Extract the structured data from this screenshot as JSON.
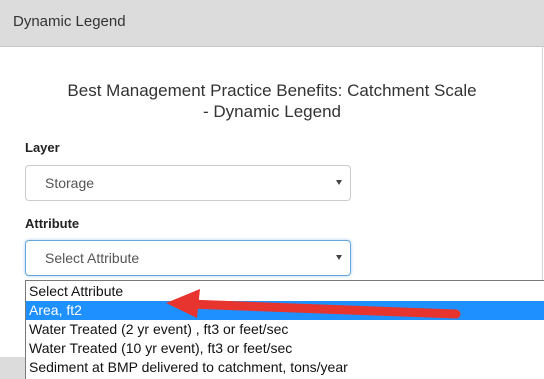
{
  "panel": {
    "title": "Dynamic Legend"
  },
  "heading": {
    "line1": "Best Management Practice Benefits: Catchment Scale",
    "line2": "- Dynamic Legend"
  },
  "layer": {
    "label": "Layer",
    "value": "Storage"
  },
  "attribute": {
    "label": "Attribute",
    "value": "Select Attribute",
    "options": [
      "Select Attribute",
      "Area, ft2",
      "Water Treated (2 yr event) , ft3 or feet/sec",
      "Water Treated (10 yr event), ft3 or feet/sec",
      "Sediment at BMP delivered to catchment, tons/year"
    ],
    "selected_index": 1
  },
  "colors": {
    "highlight": "#1e90ff",
    "annotation_arrow": "#e8342f"
  },
  "icons": [
    "caret-down-icon",
    "annotation-arrow"
  ]
}
